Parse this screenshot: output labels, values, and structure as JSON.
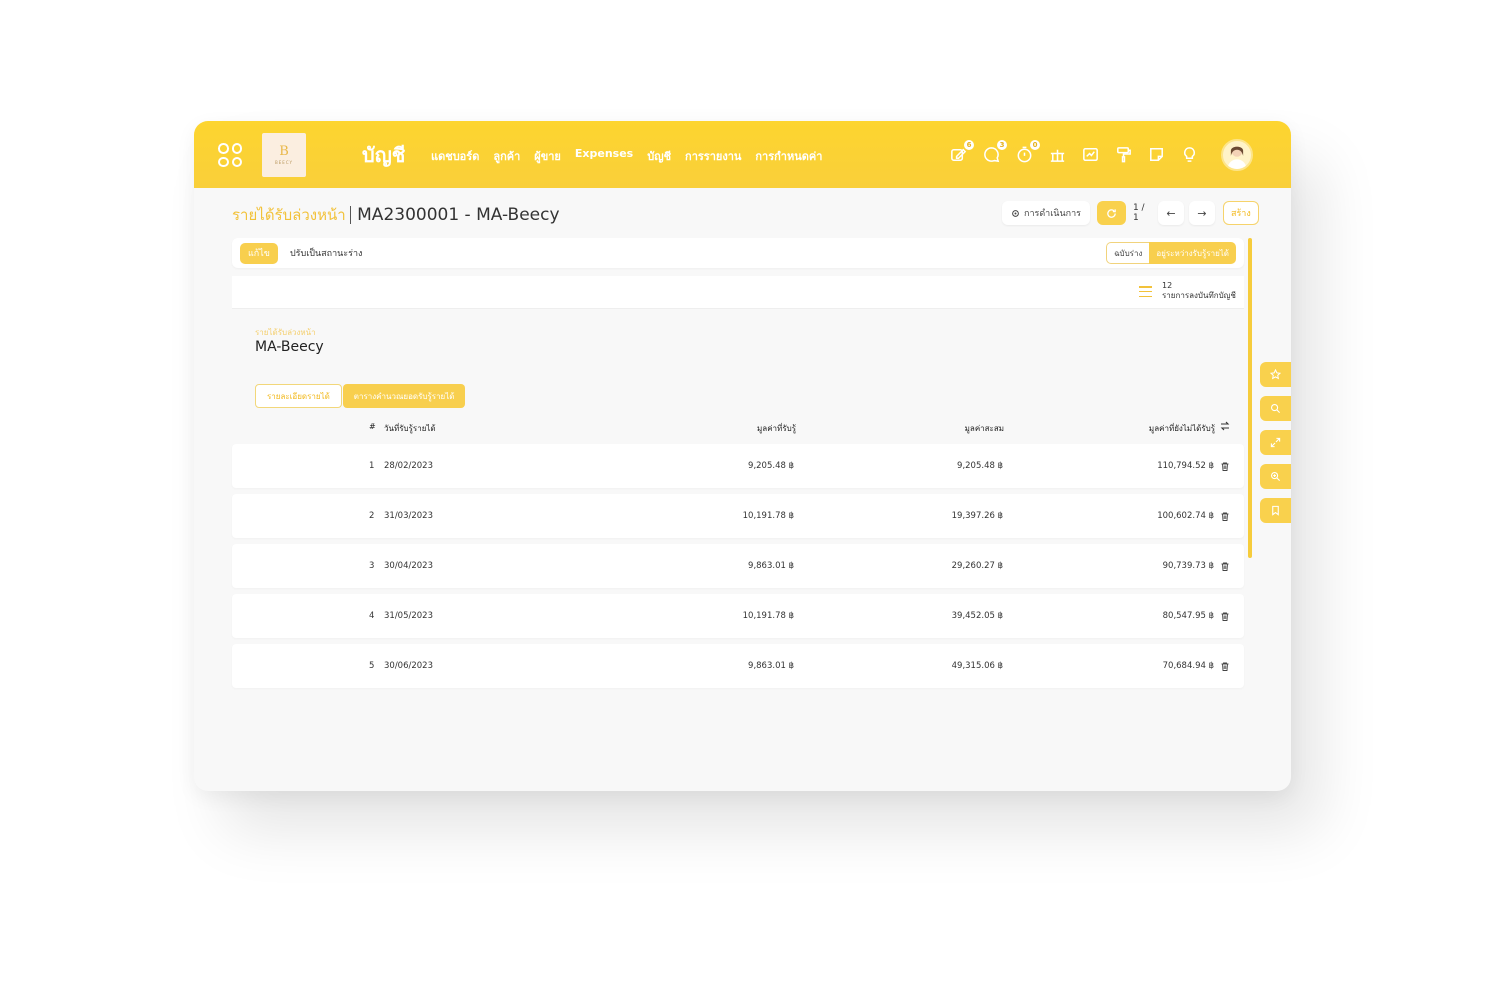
{
  "topbar": {
    "app_title": "บัญชี",
    "nav": [
      "แดชบอร์ด",
      "ลูกค้า",
      "ผู้ขาย",
      "Expenses",
      "บัญชี",
      "การรายงาน",
      "การกำหนดค่า"
    ],
    "logo_letter": "B",
    "logo_text": "BEECY",
    "icons": [
      {
        "name": "edit-note-icon",
        "badge": "6"
      },
      {
        "name": "chat-icon",
        "badge": "3"
      },
      {
        "name": "timer-icon",
        "badge": "0"
      },
      {
        "name": "bank-icon",
        "badge": ""
      },
      {
        "name": "chart-icon",
        "badge": ""
      },
      {
        "name": "paint-roller-icon",
        "badge": ""
      },
      {
        "name": "sticky-note-icon",
        "badge": ""
      },
      {
        "name": "lightbulb-icon",
        "badge": ""
      }
    ]
  },
  "breadcrumb": {
    "parent": "รายได้รับล่วงหน้า",
    "current": "MA2300001 - MA-Beecy"
  },
  "controls": {
    "action_label": "การดำเนินการ",
    "pager": "1 / 1",
    "prev": "←",
    "next": "→",
    "create_label": "สร้าง"
  },
  "status_bar": {
    "edit_label": "แก้ไข",
    "set_draft_label": "ปรับเป็นสถานะร่าง",
    "steps": [
      "ฉบับร่าง",
      "อยู่ระหว่างรับรู้รายได้"
    ]
  },
  "sheet": {
    "log_count": "12",
    "log_label": "รายการลงบันทึกบัญชี",
    "field_label": "รายได้รับล่วงหน้า",
    "field_value": "MA-Beecy",
    "tabs": [
      "รายละเอียดรายได้",
      "ตารางคำนวณยอดรับรู้รายได้"
    ],
    "columns": [
      "#",
      "วันที่รับรู้รายได้",
      "มูลค่าที่รับรู้",
      "มูลค่าสะสม",
      "มูลค่าที่ยังไม่ได้รับรู้"
    ],
    "rows": [
      {
        "no": "1",
        "date": "28/02/2023",
        "recognized": "9,205.48 ฿",
        "accumulated": "9,205.48 ฿",
        "remaining": "110,794.52 ฿"
      },
      {
        "no": "2",
        "date": "31/03/2023",
        "recognized": "10,191.78 ฿",
        "accumulated": "19,397.26 ฿",
        "remaining": "100,602.74 ฿"
      },
      {
        "no": "3",
        "date": "30/04/2023",
        "recognized": "9,863.01 ฿",
        "accumulated": "29,260.27 ฿",
        "remaining": "90,739.73 ฿"
      },
      {
        "no": "4",
        "date": "31/05/2023",
        "recognized": "10,191.78 ฿",
        "accumulated": "39,452.05 ฿",
        "remaining": "80,547.95 ฿"
      },
      {
        "no": "5",
        "date": "30/06/2023",
        "recognized": "9,863.01 ฿",
        "accumulated": "49,315.06 ฿",
        "remaining": "70,684.94 ฿"
      }
    ]
  },
  "side_tools": [
    "star-icon",
    "search-icon",
    "expand-icon",
    "zoom-in-icon",
    "bookmark-icon"
  ],
  "colors": {
    "accent": "#fdd52f",
    "accent_soft": "#f8cf4e",
    "text_accent": "#f2c23a"
  }
}
